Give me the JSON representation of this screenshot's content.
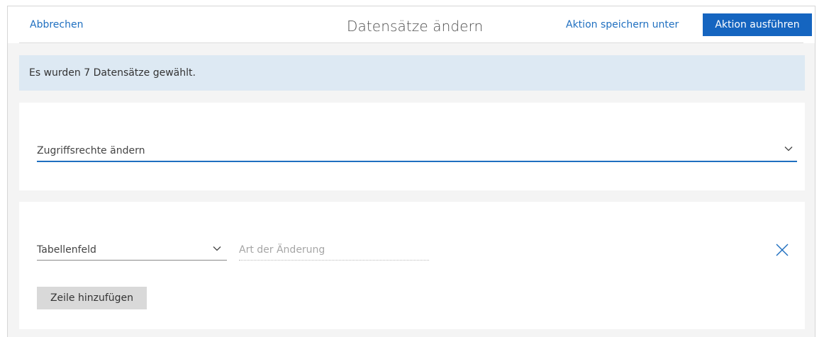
{
  "header": {
    "cancel_label": "Abbrechen",
    "title": "Datensätze ändern",
    "save_as_label": "Aktion speichern unter",
    "run_label": "Aktion ausführen"
  },
  "info": {
    "text": "Es wurden 7 Datensätze gewählt."
  },
  "access_panel": {
    "select_value": "Zugriffsrechte ändern",
    "chevron_icon": "chevron-down-icon"
  },
  "change_panel": {
    "field_value": "Tabellenfeld",
    "change_type_placeholder": "Art der Änderung",
    "remove_icon": "close-icon",
    "add_row_label": "Zeile hinzufügen"
  },
  "colors": {
    "accent": "#1f6fc0",
    "primary_button": "#1565c0",
    "info_background": "#dde9f3",
    "page_background": "#f4f4f4"
  }
}
